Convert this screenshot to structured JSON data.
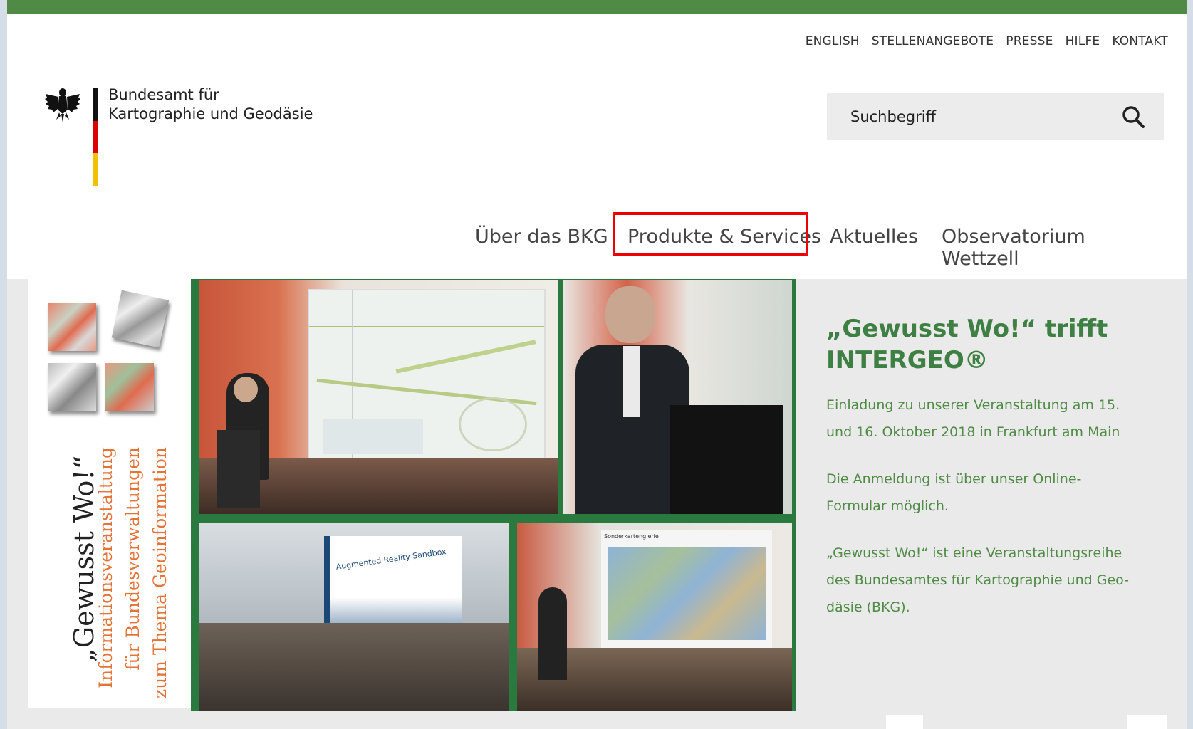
{
  "service_nav": [
    "ENGLISH",
    "STELLENANGEBOTE",
    "PRESSE",
    "HILFE",
    "KONTAKT"
  ],
  "logo": {
    "line1": "Bundesamt für",
    "line2": "Kartographie und Geodäsie"
  },
  "search": {
    "placeholder": "Suchbegriff",
    "icon": "search-icon"
  },
  "main_nav": [
    "Über das BKG",
    "Produkte & Services",
    "Aktuelles",
    "Observatorium Wettzell"
  ],
  "teaser": {
    "title": "„Gewusst Wo!“",
    "subtitle_lines": [
      "Informationsveranstaltung",
      "für Bundesverwaltungen",
      "zum Thema Geoinformation"
    ]
  },
  "collage": {
    "sandbox_sign": "Augmented Reality Sandbox",
    "screen_title": "Sonderkartenglerie"
  },
  "news": {
    "title_line1": "„Gewusst Wo!“ trifft",
    "title_line2": "INTERGEO®",
    "paragraphs": [
      [
        "Einladung zu unserer Veranstaltung am 15.",
        "und 16. Oktober 2018 in Frankfurt am Main"
      ],
      [
        "Die Anmeldung ist über unser Online-",
        "Formular möglich."
      ],
      [
        "„Gewusst Wo!“ ist eine Veranstaltungsreihe",
        "des Bundesamtes für Kartographie und Geo-",
        "däsie (BKG)."
      ]
    ]
  },
  "colors": {
    "green": "#4f8b45",
    "highlight": "#ee0000",
    "orange": "#e37439"
  }
}
